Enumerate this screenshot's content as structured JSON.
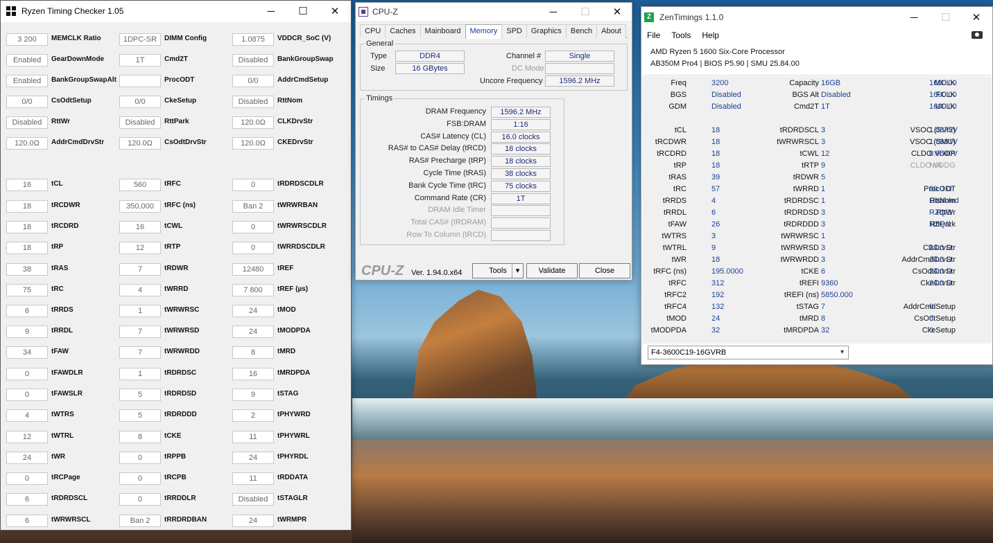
{
  "rtc": {
    "title": "Ryzen Timing Checker 1.05",
    "cells": [
      {
        "v": "3 200",
        "l": "MEMCLK Ratio"
      },
      {
        "v": "1DPC-SR",
        "l": "DIMM Config"
      },
      {
        "v": "1.0875",
        "l": "VDDCR_SoC (V)"
      },
      {
        "v": "Enabled",
        "l": "GearDownMode"
      },
      {
        "v": "1T",
        "l": "Cmd2T"
      },
      {
        "v": "Disabled",
        "l": "BankGroupSwap"
      },
      {
        "v": "Enabled",
        "l": "BankGroupSwapAlt"
      },
      {
        "v": "",
        "l": "ProcODT"
      },
      {
        "v": "0/0",
        "l": "AddrCmdSetup"
      },
      {
        "v": "0/0",
        "l": "CsOdtSetup"
      },
      {
        "v": "0/0",
        "l": "CkeSetup"
      },
      {
        "v": "Disabled",
        "l": "RttNom"
      },
      {
        "v": "Disabled",
        "l": "RttWr"
      },
      {
        "v": "Disabled",
        "l": "RttPark"
      },
      {
        "v": "120.0Ω",
        "l": "CLKDrvStr"
      },
      {
        "v": "120.0Ω",
        "l": "AddrCmdDrvStr"
      },
      {
        "v": "120.0Ω",
        "l": "CsOdtDrvStr"
      },
      {
        "v": "120.0Ω",
        "l": "CKEDrvStr"
      },
      {
        "v": "16",
        "l": "tCL"
      },
      {
        "v": "560",
        "l": "tRFC"
      },
      {
        "v": "0",
        "l": "tRDRDSCDLR"
      },
      {
        "v": "18",
        "l": "tRCDWR"
      },
      {
        "v": "350,000",
        "l": "tRFC (ns)"
      },
      {
        "v": "Ban 2",
        "l": "tWRWRBAN"
      },
      {
        "v": "18",
        "l": "tRCDRD"
      },
      {
        "v": "16",
        "l": "tCWL"
      },
      {
        "v": "0",
        "l": "tWRWRSCDLR"
      },
      {
        "v": "18",
        "l": "tRP"
      },
      {
        "v": "12",
        "l": "tRTP"
      },
      {
        "v": "0",
        "l": "tWRRDSCDLR"
      },
      {
        "v": "38",
        "l": "tRAS"
      },
      {
        "v": "7",
        "l": "tRDWR"
      },
      {
        "v": "12480",
        "l": "tREF"
      },
      {
        "v": "75",
        "l": "tRC"
      },
      {
        "v": "4",
        "l": "tWRRD"
      },
      {
        "v": "7 800",
        "l": "tREF (µs)"
      },
      {
        "v": "6",
        "l": "tRRDS"
      },
      {
        "v": "1",
        "l": "tWRWRSC"
      },
      {
        "v": "24",
        "l": "tMOD"
      },
      {
        "v": "9",
        "l": "tRRDL"
      },
      {
        "v": "7",
        "l": "tWRWRSD"
      },
      {
        "v": "24",
        "l": "tMODPDA"
      },
      {
        "v": "34",
        "l": "tFAW"
      },
      {
        "v": "7",
        "l": "tWRWRDD"
      },
      {
        "v": "8",
        "l": "tMRD"
      },
      {
        "v": "0",
        "l": "tFAWDLR"
      },
      {
        "v": "1",
        "l": "tRDRDSC"
      },
      {
        "v": "16",
        "l": "tMRDPDA"
      },
      {
        "v": "0",
        "l": "tFAWSLR"
      },
      {
        "v": "5",
        "l": "tRDRDSD"
      },
      {
        "v": "9",
        "l": "tSTAG"
      },
      {
        "v": "4",
        "l": "tWTRS"
      },
      {
        "v": "5",
        "l": "tRDRDDD"
      },
      {
        "v": "2",
        "l": "tPHYWRD"
      },
      {
        "v": "12",
        "l": "tWTRL"
      },
      {
        "v": "8",
        "l": "tCKE"
      },
      {
        "v": "11",
        "l": "tPHYWRL"
      },
      {
        "v": "24",
        "l": "tWR"
      },
      {
        "v": "0",
        "l": "tRPPB"
      },
      {
        "v": "24",
        "l": "tPHYRDL"
      },
      {
        "v": "0",
        "l": "tRCPage"
      },
      {
        "v": "0",
        "l": "tRCPB"
      },
      {
        "v": "11",
        "l": "tRDDATA"
      },
      {
        "v": "6",
        "l": "tRDRDSCL"
      },
      {
        "v": "0",
        "l": "tRRDDLR"
      },
      {
        "v": "Disabled",
        "l": "tSTAGLR"
      },
      {
        "v": "6",
        "l": "tWRWRSCL"
      },
      {
        "v": "Ban 2",
        "l": "tRRDRDBAN"
      },
      {
        "v": "24",
        "l": "tWRMPR"
      }
    ]
  },
  "cpuz": {
    "title": "CPU-Z",
    "tabs": [
      "CPU",
      "Caches",
      "Mainboard",
      "Memory",
      "SPD",
      "Graphics",
      "Bench",
      "About"
    ],
    "general_label": "General",
    "type_label": "Type",
    "type": "DDR4",
    "size_label": "Size",
    "size": "16 GBytes",
    "channel_label": "Channel #",
    "channel": "Single",
    "dcmode_label": "DC Mode",
    "dcmode": "",
    "uncore_label": "Uncore Frequency",
    "uncore": "1596.2 MHz",
    "timings_label": "Timings",
    "timings": [
      {
        "l": "DRAM Frequency",
        "v": "1596.2 MHz",
        "dim": false
      },
      {
        "l": "FSB:DRAM",
        "v": "1:16",
        "dim": false
      },
      {
        "l": "CAS# Latency (CL)",
        "v": "16.0 clocks",
        "dim": false
      },
      {
        "l": "RAS# to CAS# Delay (tRCD)",
        "v": "18 clocks",
        "dim": false
      },
      {
        "l": "RAS# Precharge (tRP)",
        "v": "18 clocks",
        "dim": false
      },
      {
        "l": "Cycle Time (tRAS)",
        "v": "38 clocks",
        "dim": false
      },
      {
        "l": "Bank Cycle Time (tRC)",
        "v": "75 clocks",
        "dim": false
      },
      {
        "l": "Command Rate (CR)",
        "v": "1T",
        "dim": false
      },
      {
        "l": "DRAM Idle Timer",
        "v": "",
        "dim": true
      },
      {
        "l": "Total CAS# (tRDRAM)",
        "v": "",
        "dim": true
      },
      {
        "l": "Row To Column (tRCD)",
        "v": "",
        "dim": true
      }
    ],
    "brand": "CPU-Z",
    "version": "Ver. 1.94.0.x64",
    "tools": "Tools",
    "validate": "Validate",
    "close": "Close"
  },
  "zt": {
    "title": "ZenTimings 1.1.0",
    "menu": [
      "File",
      "Tools",
      "Help"
    ],
    "cpu": "AMD Ryzen 5 1600 Six-Core Processor",
    "board": "AB350M Pro4 | BIOS P5.90 | SMU 25.84.00",
    "rows": [
      [
        {
          "l": "Freq",
          "v": "3200"
        },
        {
          "l": "Capacity",
          "v": "16GB"
        },
        {
          "l": "MCLK",
          "v": "1600.00"
        }
      ],
      [
        {
          "l": "BGS",
          "v": "Disabled"
        },
        {
          "l": "BGS Alt",
          "v": "Disabled"
        },
        {
          "l": "FCLK",
          "v": "1600.00"
        }
      ],
      [
        {
          "l": "GDM",
          "v": "Disabled"
        },
        {
          "l": "Cmd2T",
          "v": "1T"
        },
        {
          "l": "UCLK",
          "v": "1600.00"
        }
      ],
      [],
      [
        {
          "l": "tCL",
          "v": "18"
        },
        {
          "l": "tRDRDSCL",
          "v": "3"
        },
        {
          "l": "VSOC (SVI2)",
          "v": "1.0875V"
        }
      ],
      [
        {
          "l": "tRCDWR",
          "v": "18"
        },
        {
          "l": "tWRWRSCL",
          "v": "3"
        },
        {
          "l": "VSOC (SMU)",
          "v": "1.0881V"
        }
      ],
      [
        {
          "l": "tRCDRD",
          "v": "18"
        },
        {
          "l": "tCWL",
          "v": "12"
        },
        {
          "l": "CLDO VDDP",
          "v": "0.9500V"
        }
      ],
      [
        {
          "l": "tRP",
          "v": "18"
        },
        {
          "l": "tRTP",
          "v": "9"
        },
        {
          "l": "CLDO VDDG",
          "v": "N/A",
          "dim": true
        }
      ],
      [
        {
          "l": "tRAS",
          "v": "39"
        },
        {
          "l": "tRDWR",
          "v": "5"
        },
        {
          "l": "",
          "v": ""
        }
      ],
      [
        {
          "l": "tRC",
          "v": "57"
        },
        {
          "l": "tWRRD",
          "v": "1"
        },
        {
          "l": "ProcODT",
          "v": "60.0 Ω"
        }
      ],
      [
        {
          "l": "tRRDS",
          "v": "4"
        },
        {
          "l": "tRDRDSC",
          "v": "1"
        },
        {
          "l": "RttNom",
          "v": "Disabled"
        }
      ],
      [
        {
          "l": "tRRDL",
          "v": "6"
        },
        {
          "l": "tRDRDSD",
          "v": "3"
        },
        {
          "l": "RttWr",
          "v": "RZQ/3"
        }
      ],
      [
        {
          "l": "tFAW",
          "v": "26"
        },
        {
          "l": "tRDRDDD",
          "v": "3"
        },
        {
          "l": "RttPark",
          "v": "RZQ/1"
        }
      ],
      [
        {
          "l": "tWTRS",
          "v": "3"
        },
        {
          "l": "tWRWRSC",
          "v": "1"
        },
        {
          "l": "",
          "v": ""
        }
      ],
      [
        {
          "l": "tWTRL",
          "v": "9"
        },
        {
          "l": "tWRWRSD",
          "v": "3"
        },
        {
          "l": "ClkDrvStr",
          "v": "24.0 Ω"
        }
      ],
      [
        {
          "l": "tWR",
          "v": "18"
        },
        {
          "l": "tWRWRDD",
          "v": "3"
        },
        {
          "l": "AddrCmdDrvStr",
          "v": "24.0 Ω"
        }
      ],
      [
        {
          "l": "tRFC (ns)",
          "v": "195.0000"
        },
        {
          "l": "tCKE",
          "v": "6"
        },
        {
          "l": "CsOdtDrvStr",
          "v": "24.0 Ω"
        }
      ],
      [
        {
          "l": "tRFC",
          "v": "312"
        },
        {
          "l": "tREFI",
          "v": "9360"
        },
        {
          "l": "CkeDrvStr",
          "v": "24.0 Ω"
        }
      ],
      [
        {
          "l": "tRFC2",
          "v": "192"
        },
        {
          "l": "tREFI (ns)",
          "v": "5850.000"
        },
        {
          "l": "",
          "v": ""
        }
      ],
      [
        {
          "l": "tRFC4",
          "v": "132"
        },
        {
          "l": "tSTAG",
          "v": "7"
        },
        {
          "l": "AddrCmdSetup",
          "v": "0"
        }
      ],
      [
        {
          "l": "tMOD",
          "v": "24"
        },
        {
          "l": "tMRD",
          "v": "8"
        },
        {
          "l": "CsOdtSetup",
          "v": "0"
        }
      ],
      [
        {
          "l": "tMODPDA",
          "v": "32"
        },
        {
          "l": "tMRDPDA",
          "v": "32"
        },
        {
          "l": "CkeSetup",
          "v": "0"
        }
      ]
    ],
    "profile": "F4-3600C19-16GVRB"
  },
  "colors": {
    "zt_value": "#1c3f95",
    "cpuz_value": "#1a2a7a",
    "zt_icon": "#1aa34a"
  },
  "icons": {
    "minimize": "─",
    "maximize": "☐",
    "close": "✕",
    "dropdown": "▾"
  }
}
